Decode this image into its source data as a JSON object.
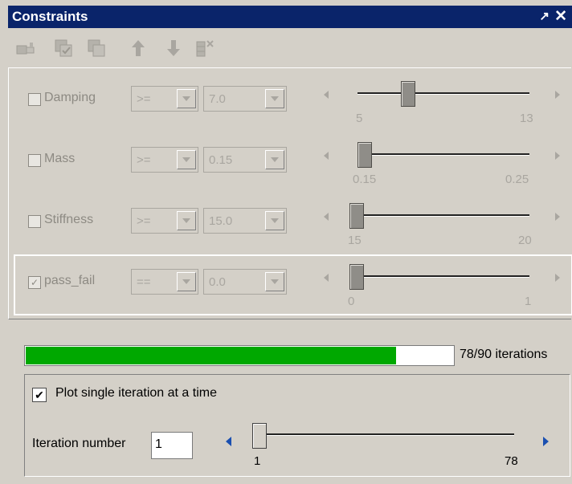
{
  "title_bar": {
    "title": "Constraints",
    "pin_icon": "pin-icon",
    "close_icon": "close-icon",
    "pin_glyph": "↗",
    "close_glyph": "✕"
  },
  "toolbar": {
    "icons": [
      "constraint-editor-icon",
      "copy-checked-icon",
      "copy-icon",
      "move-up-icon",
      "move-down-icon",
      "delete-column-icon"
    ]
  },
  "constraints": [
    {
      "label": "Damping",
      "checked": false,
      "operator": ">=",
      "value": "7.0",
      "min": "5",
      "max": "13",
      "slider_value": 7.0
    },
    {
      "label": "Mass",
      "checked": false,
      "operator": ">=",
      "value": "0.15",
      "min": "0.15",
      "max": "0.25",
      "slider_value": 0.15
    },
    {
      "label": "Stiffness",
      "checked": false,
      "operator": ">=",
      "value": "15.0",
      "min": "15",
      "max": "20",
      "slider_value": 15.0
    },
    {
      "label": "pass_fail",
      "checked": true,
      "operator": "==",
      "value": "0.0",
      "min": "0",
      "max": "1",
      "slider_value": 0.0
    }
  ],
  "progress": {
    "completed": 78,
    "total": 90,
    "text": "78/90 iterations",
    "color": "#00a800"
  },
  "plot_single": {
    "checked": true,
    "label": "Plot single iteration at a time"
  },
  "iteration": {
    "label": "Iteration number",
    "value": "1",
    "min": "1",
    "max": "78",
    "slider_value": 1
  },
  "colors": {
    "title_bar": "#0a246a",
    "panel": "#d4d0c8",
    "disabled_text": "#8d8a83",
    "arrow_blue": "#1a4fb0"
  }
}
